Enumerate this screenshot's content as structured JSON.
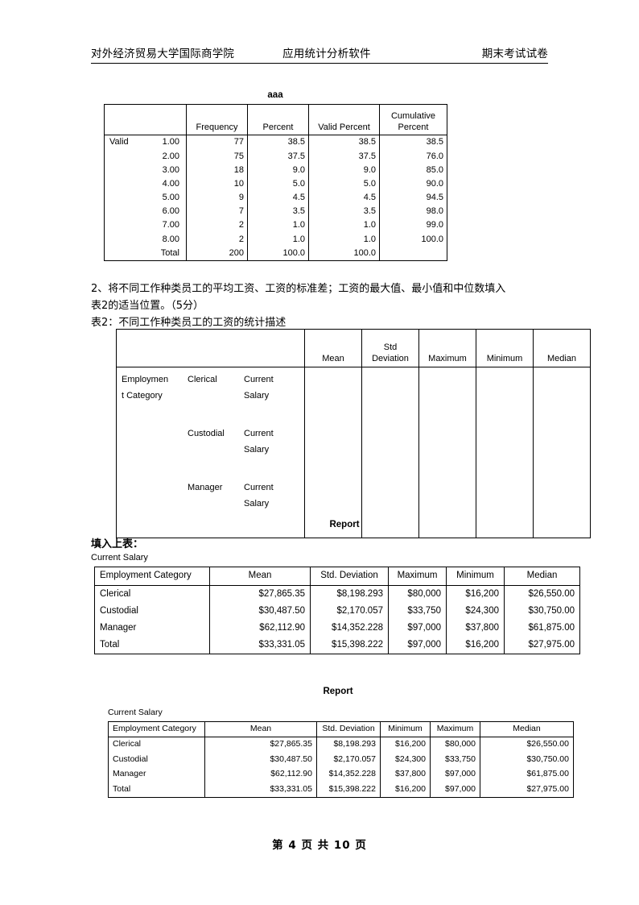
{
  "header": {
    "left": "对外经济贸易大学国际商学院",
    "middle": "应用统计分析软件",
    "right": "期末考试试卷"
  },
  "freq_table": {
    "title": "aaa",
    "columns": [
      "",
      "",
      "Frequency",
      "Percent",
      "Valid Percent",
      "Cumulative Percent"
    ],
    "col_headers": {
      "frequency": "Frequency",
      "percent": "Percent",
      "valid_percent": "Valid Percent",
      "cumulative_percent_line1": "Cumulative",
      "cumulative_percent_line2": "Percent"
    },
    "valid_label": "Valid",
    "total_label": "Total",
    "rows": [
      {
        "category": "1.00",
        "frequency": "77",
        "percent": "38.5",
        "valid_percent": "38.5",
        "cumulative_percent": "38.5"
      },
      {
        "category": "2.00",
        "frequency": "75",
        "percent": "37.5",
        "valid_percent": "37.5",
        "cumulative_percent": "76.0"
      },
      {
        "category": "3.00",
        "frequency": "18",
        "percent": "9.0",
        "valid_percent": "9.0",
        "cumulative_percent": "85.0"
      },
      {
        "category": "4.00",
        "frequency": "10",
        "percent": "5.0",
        "valid_percent": "5.0",
        "cumulative_percent": "90.0"
      },
      {
        "category": "5.00",
        "frequency": "9",
        "percent": "4.5",
        "valid_percent": "4.5",
        "cumulative_percent": "94.5"
      },
      {
        "category": "6.00",
        "frequency": "7",
        "percent": "3.5",
        "valid_percent": "3.5",
        "cumulative_percent": "98.0"
      },
      {
        "category": "7.00",
        "frequency": "2",
        "percent": "1.0",
        "valid_percent": "1.0",
        "cumulative_percent": "99.0"
      },
      {
        "category": "8.00",
        "frequency": "2",
        "percent": "1.0",
        "valid_percent": "1.0",
        "cumulative_percent": "100.0"
      }
    ],
    "total": {
      "category": "Total",
      "frequency": "200",
      "percent": "100.0",
      "valid_percent": "100.0",
      "cumulative_percent": ""
    }
  },
  "question2": {
    "line1": "2、将不同工作种类员工的平均工资、工资的标准差；工资的最大值、最小值和中位数填入",
    "line2": "表2的适当位置。（5分）",
    "table_caption": "表2：不同工作种类员工的工资的统计描述"
  },
  "blank_table": {
    "headers": {
      "mean": "Mean",
      "std_deviation_line1": "Std",
      "std_deviation_line2": "Deviation",
      "maximum": "Maximum",
      "minimum": "Minimum",
      "median": "Median"
    },
    "row_group_line1": "Employmen",
    "row_group_line2": "t Category",
    "rows": [
      {
        "category": "Clerical",
        "measure_line1": "Current",
        "measure_line2": "Salary",
        "mean": "",
        "std_deviation": "",
        "maximum": "",
        "minimum": "",
        "median": ""
      },
      {
        "category": "Custodial",
        "measure_line1": "Current",
        "measure_line2": "Salary",
        "mean": "",
        "std_deviation": "",
        "maximum": "",
        "minimum": "",
        "median": ""
      },
      {
        "category": "Manager",
        "measure_line1": "Current",
        "measure_line2": "Salary",
        "mean": "",
        "std_deviation": "",
        "maximum": "",
        "minimum": "",
        "median": ""
      }
    ],
    "report_label": "Report"
  },
  "fill_section": {
    "heading": "填入上表："
  },
  "report_table_1": {
    "subtitle": "Current Salary",
    "columns": [
      "Employment Category",
      "Mean",
      "Std. Deviation",
      "Maximum",
      "Minimum",
      "Median"
    ],
    "rows": [
      {
        "category": "Clerical",
        "mean": "$27,865.35",
        "std_deviation": "$8,198.293",
        "maximum": "$80,000",
        "minimum": "$16,200",
        "median": "$26,550.00"
      },
      {
        "category": "Custodial",
        "mean": "$30,487.50",
        "std_deviation": "$2,170.057",
        "maximum": "$33,750",
        "minimum": "$24,300",
        "median": "$30,750.00"
      },
      {
        "category": "Manager",
        "mean": "$62,112.90",
        "std_deviation": "$14,352.228",
        "maximum": "$97,000",
        "minimum": "$37,800",
        "median": "$61,875.00"
      },
      {
        "category": "Total",
        "mean": "$33,331.05",
        "std_deviation": "$15,398.222",
        "maximum": "$97,000",
        "minimum": "$16,200",
        "median": "$27,975.00"
      }
    ]
  },
  "report_table_2": {
    "report_label": "Report",
    "subtitle": "Current Salary",
    "columns": [
      "Employment Category",
      "Mean",
      "Std. Deviation",
      "Minimum",
      "Maximum",
      "Median"
    ],
    "rows": [
      {
        "category": "Clerical",
        "mean": "$27,865.35",
        "std_deviation": "$8,198.293",
        "minimum": "$16,200",
        "maximum": "$80,000",
        "median": "$26,550.00"
      },
      {
        "category": "Custodial",
        "mean": "$30,487.50",
        "std_deviation": "$2,170.057",
        "minimum": "$24,300",
        "maximum": "$33,750",
        "median": "$30,750.00"
      },
      {
        "category": "Manager",
        "mean": "$62,112.90",
        "std_deviation": "$14,352.228",
        "minimum": "$37,800",
        "maximum": "$97,000",
        "median": "$61,875.00"
      },
      {
        "category": "Total",
        "mean": "$33,331.05",
        "std_deviation": "$15,398.222",
        "minimum": "$16,200",
        "maximum": "$97,000",
        "median": "$27,975.00"
      }
    ]
  },
  "footer": {
    "text": "第 4 页 共 10 页"
  }
}
